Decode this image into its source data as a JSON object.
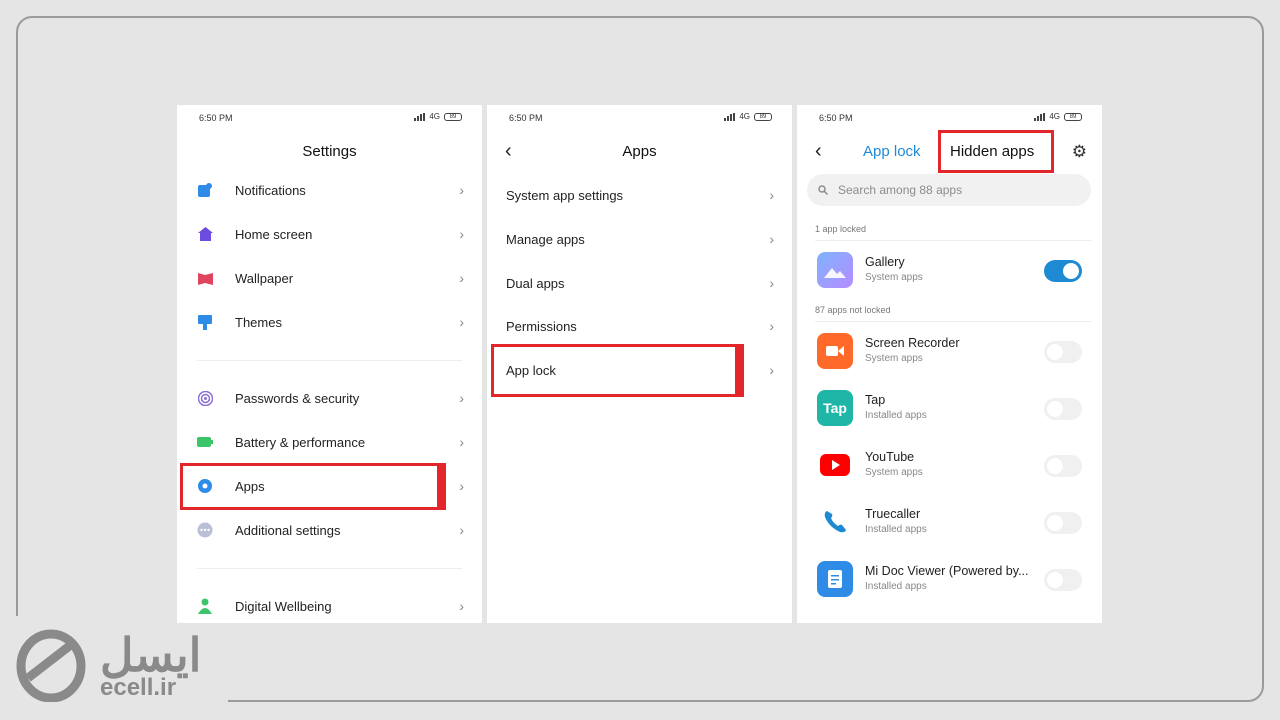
{
  "status": {
    "time": "6:50 PM",
    "network": "4G",
    "battery": "89"
  },
  "settings": {
    "title": "Settings",
    "items": [
      {
        "label": "Notifications"
      },
      {
        "label": "Home screen"
      },
      {
        "label": "Wallpaper"
      },
      {
        "label": "Themes"
      },
      {
        "label": "Passwords & security"
      },
      {
        "label": "Battery & performance"
      },
      {
        "label": "Apps"
      },
      {
        "label": "Additional settings"
      },
      {
        "label": "Digital Wellbeing"
      }
    ]
  },
  "apps": {
    "title": "Apps",
    "items": [
      {
        "label": "System app settings"
      },
      {
        "label": "Manage apps"
      },
      {
        "label": "Dual apps"
      },
      {
        "label": "Permissions"
      },
      {
        "label": "App lock"
      }
    ]
  },
  "applock": {
    "tab_active": "App lock",
    "tab_hidden": "Hidden apps",
    "search_placeholder": "Search among 88 apps",
    "locked_header": "1 app locked",
    "unlocked_header": "87 apps not locked",
    "locked": [
      {
        "name": "Gallery",
        "sub": "System apps",
        "on": true
      }
    ],
    "unlocked": [
      {
        "name": "Screen Recorder",
        "sub": "System apps"
      },
      {
        "name": "Tap",
        "sub": "Installed apps",
        "icon_text": "Tap"
      },
      {
        "name": "YouTube",
        "sub": "System apps"
      },
      {
        "name": "Truecaller",
        "sub": "Installed apps"
      },
      {
        "name": "Mi Doc Viewer (Powered by...",
        "sub": "Installed apps"
      }
    ]
  },
  "watermark": {
    "fa": "ایسل",
    "en": "ecell.ir"
  },
  "colors": {
    "accent": "#1f8ad4",
    "highlight": "#e3262b"
  }
}
